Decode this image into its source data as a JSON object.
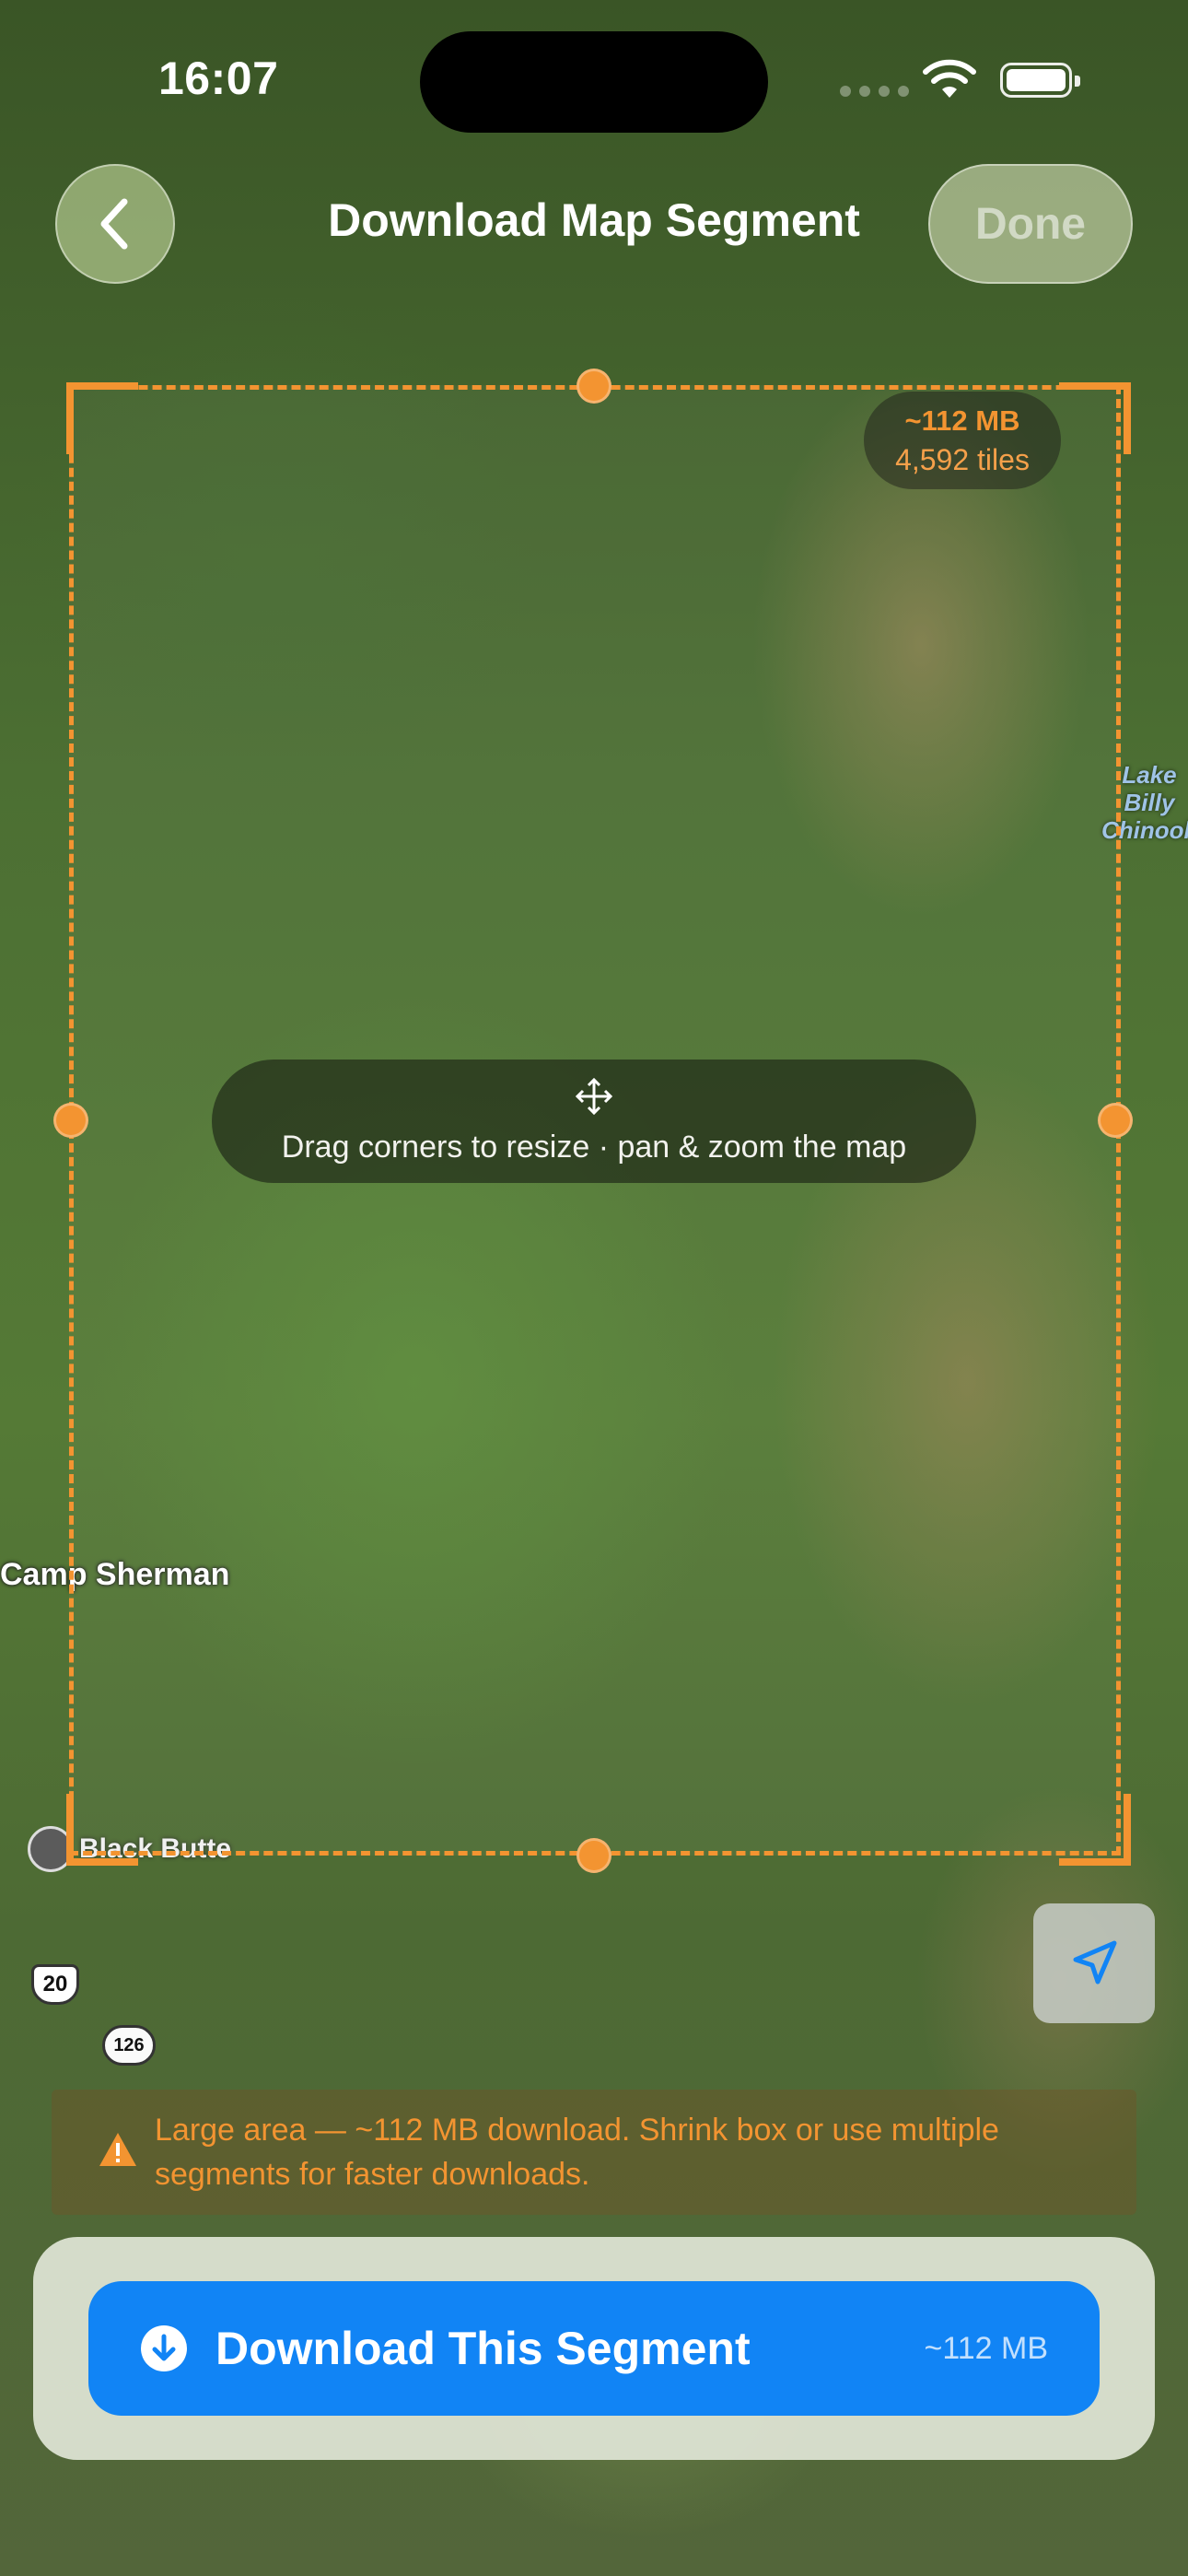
{
  "status_bar": {
    "time": "16:07"
  },
  "nav": {
    "title": "Download Map Segment",
    "done_label": "Done"
  },
  "selection": {
    "size": "~112 MB",
    "tiles": "4,592 tiles"
  },
  "hint": {
    "text": "Drag corners to resize · pan & zoom the map"
  },
  "map_labels": {
    "lake": "Lake\nBilly\nChinook",
    "camp": "Camp Sherman",
    "butte": "Black Butte",
    "route_20": "20",
    "route_126": "126"
  },
  "warning": {
    "text": "Large area — ~112 MB download. Shrink box or use multiple segments for faster downloads."
  },
  "download": {
    "label": "Download This Segment",
    "size": "~112 MB"
  },
  "colors": {
    "accent_orange": "#f39431",
    "download_blue": "#1184f5"
  },
  "icons": [
    "back-chevron-icon",
    "move-icon",
    "location-arrow-icon",
    "warning-icon",
    "download-arrow-icon",
    "wifi-icon",
    "battery-icon"
  ]
}
